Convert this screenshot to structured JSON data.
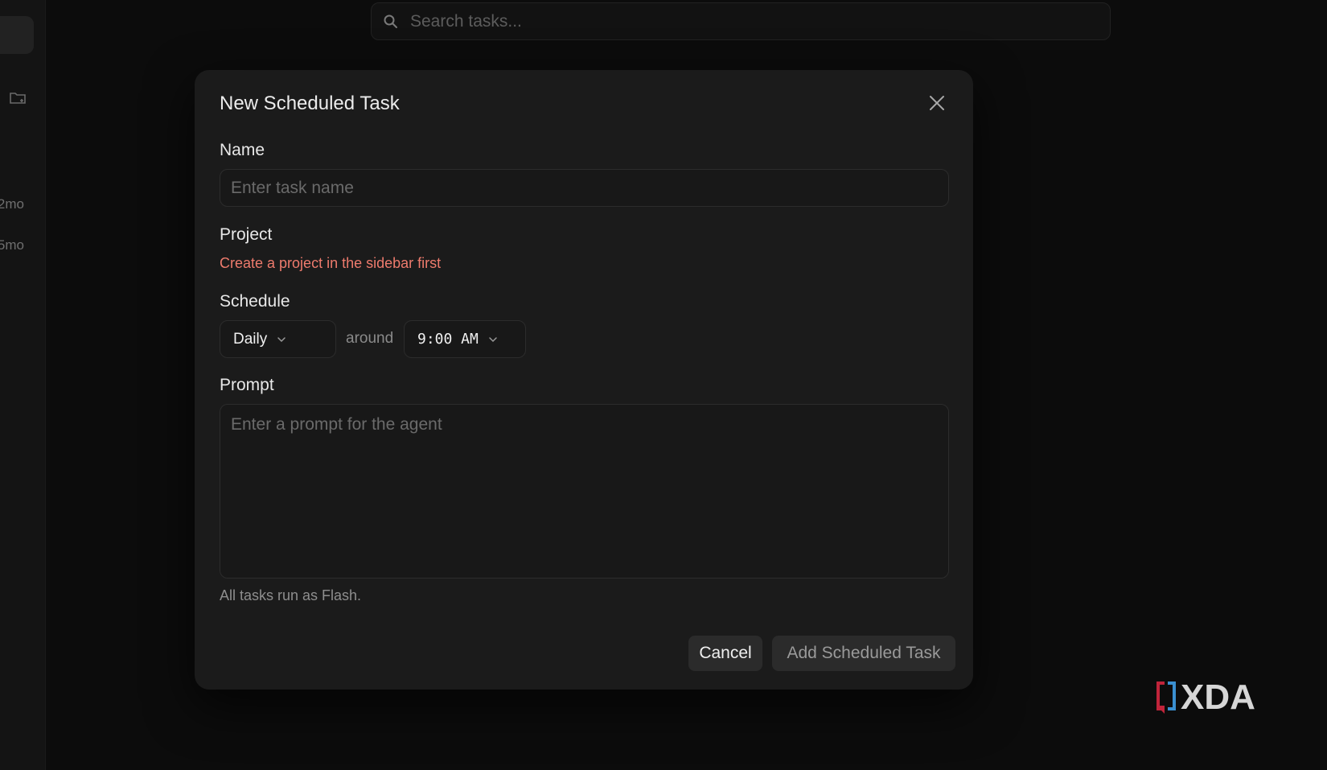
{
  "sidebar": {
    "times": [
      "2mo",
      "5mo"
    ]
  },
  "search": {
    "placeholder": "Search tasks..."
  },
  "modal": {
    "title": "New Scheduled Task",
    "name_label": "Name",
    "name_placeholder": "Enter task name",
    "project_label": "Project",
    "project_warning": "Create a project in the sidebar first",
    "schedule_label": "Schedule",
    "frequency": "Daily",
    "around_text": "around",
    "time": "9:00 AM",
    "prompt_label": "Prompt",
    "prompt_placeholder": "Enter a prompt for the agent",
    "hint": "All tasks run as Flash.",
    "cancel_label": "Cancel",
    "add_label": "Add Scheduled Task"
  },
  "watermark": {
    "text": "XDA"
  },
  "colors": {
    "warning": "#ee7b6d",
    "modal_bg": "#1b1b1b",
    "page_bg": "#0c0c0c"
  }
}
